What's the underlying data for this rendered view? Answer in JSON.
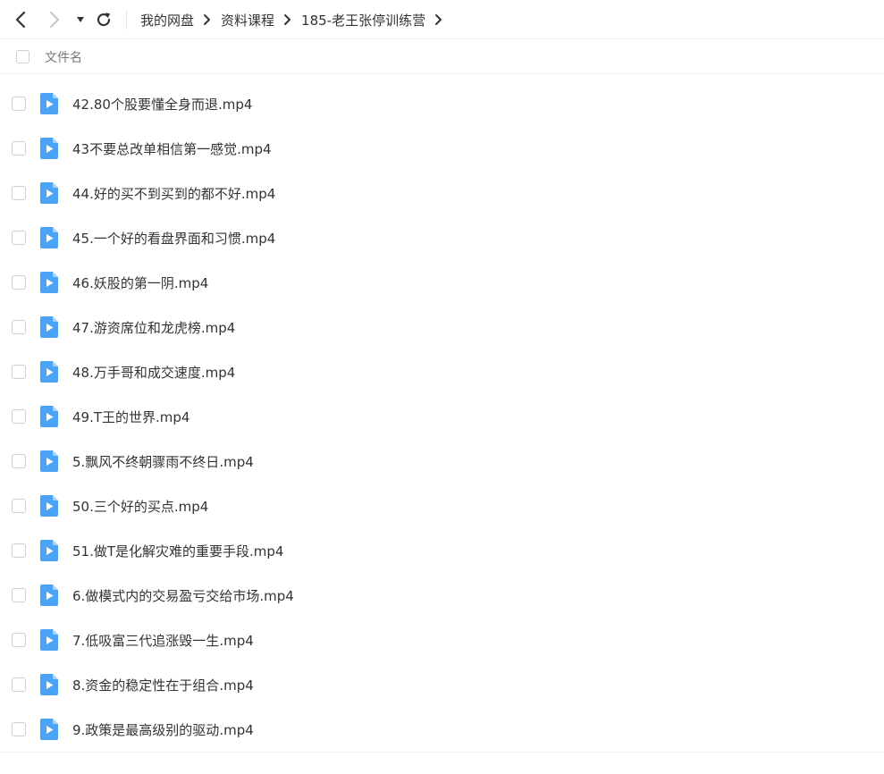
{
  "toolbar": {
    "back_icon": "chevron-left-icon",
    "forward_icon": "chevron-right-icon",
    "history_icon": "caret-down-icon",
    "refresh_icon": "refresh-icon"
  },
  "breadcrumb": [
    "我的网盘",
    "资料课程",
    "185-老王张停训练营"
  ],
  "header": {
    "column_name": "文件名"
  },
  "files": [
    {
      "name": "42.80个股要懂全身而退.mp4"
    },
    {
      "name": "43不要总改单相信第一感觉.mp4"
    },
    {
      "name": "44.好的买不到买到的都不好.mp4"
    },
    {
      "name": "45.一个好的看盘界面和习惯.mp4"
    },
    {
      "name": "46.妖股的第一阴.mp4"
    },
    {
      "name": "47.游资席位和龙虎榜.mp4"
    },
    {
      "name": "48.万手哥和成交速度.mp4"
    },
    {
      "name": "49.T王的世界.mp4"
    },
    {
      "name": "5.飘风不终朝骤雨不终日.mp4"
    },
    {
      "name": "50.三个好的买点.mp4"
    },
    {
      "name": "51.做T是化解灾难的重要手段.mp4"
    },
    {
      "name": "6.做模式内的交易盈亏交给市场.mp4"
    },
    {
      "name": "7.低吸富三代追涨毁一生.mp4"
    },
    {
      "name": "8.资金的稳定性在于组合.mp4"
    },
    {
      "name": "9.政策是最高级别的驱动.mp4"
    }
  ],
  "colors": {
    "video_icon": "#4aa3f5",
    "text": "#333333",
    "muted": "#777777",
    "border": "#eeeeee"
  }
}
